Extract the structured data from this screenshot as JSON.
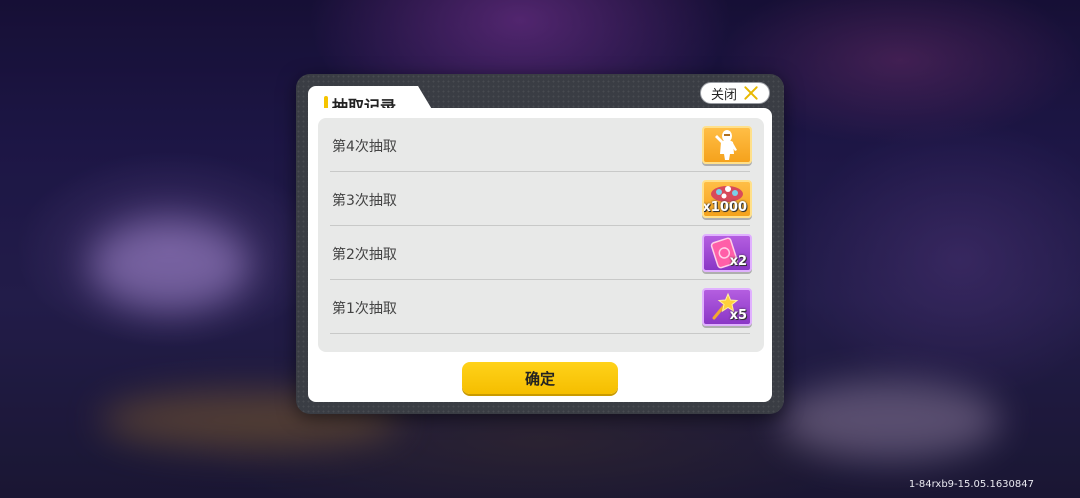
{
  "dialog": {
    "title": "抽取记录",
    "close_label": "关闭",
    "confirm_label": "确定"
  },
  "records": [
    {
      "label": "第4次抽取",
      "item_icon": "character-icon",
      "count": "",
      "rarity_color": "#f5a21c"
    },
    {
      "label": "第3次抽取",
      "item_icon": "gem-pile-icon",
      "count": "x1000",
      "rarity_color": "#f5a21c"
    },
    {
      "label": "第2次抽取",
      "item_icon": "pink-card-icon",
      "count": "x2",
      "rarity_color": "#8a36c6"
    },
    {
      "label": "第1次抽取",
      "item_icon": "star-wand-icon",
      "count": "x5",
      "rarity_color": "#8a36c6"
    }
  ],
  "footer": {
    "version": "1-84rxb9-15.05.1630847"
  }
}
